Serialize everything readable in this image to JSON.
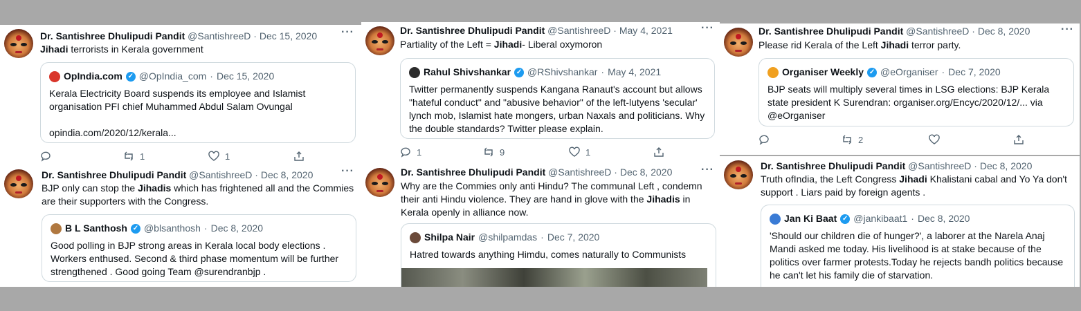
{
  "tweets": [
    {
      "name": "Dr. Santishree Dhulipudi Pandit",
      "handle": "@SantishreeD",
      "date": "Dec 15, 2020",
      "text_bold": "Jihadi",
      "text_after": " terrorists in Kerala government",
      "quote": {
        "name": "OpIndia.com",
        "handle": "@OpIndia_com",
        "date": "Dec 15, 2020",
        "text": "Kerala Electricity Board suspends its employee and Islamist organisation PFI chief Muhammed Abdul Salam Ovungal",
        "link": "opindia.com/2020/12/kerala..."
      },
      "actions": {
        "reply": "",
        "retweet": "1",
        "like": "1"
      }
    },
    {
      "name": "Dr. Santishree Dhulipudi Pandit",
      "handle": "@SantishreeD",
      "date": "May 4, 2021",
      "text_before": "Partiality of the Left = ",
      "text_bold": "Jihadi",
      "text_after": "- Liberal oxymoron",
      "quote": {
        "name": "Rahul Shivshankar",
        "handle": "@RShivshankar",
        "date": "May 4, 2021",
        "text": "Twitter permanently suspends Kangana Ranaut's account but allows \"hateful conduct\" and \"abusive behavior\" of the left-lutyens 'secular' lynch mob, Islamist hate mongers, urban Naxals and politicians. Why the double standards? Twitter please explain."
      },
      "actions": {
        "reply": "1",
        "retweet": "9",
        "like": "1"
      }
    },
    {
      "name": "Dr. Santishree Dhulipudi Pandit",
      "handle": "@SantishreeD",
      "date": "Dec 8, 2020",
      "text_before": "Please rid Kerala of the Left ",
      "text_bold": "Jihadi",
      "text_after": " terror party.",
      "quote": {
        "name": "Organiser Weekly",
        "handle": "@eOrganiser",
        "date": "Dec 7, 2020",
        "text": "BJP seats will multiply several times in LSG elections: BJP Kerala state president K Surendran: organiser.org/Encyc/2020/12/... via @eOrganiser"
      },
      "actions": {
        "reply": "",
        "retweet": "2",
        "like": ""
      }
    },
    {
      "name": "Dr. Santishree Dhulipudi Pandit",
      "handle": "@SantishreeD",
      "date": "Dec 8, 2020",
      "text_before": "BJP only can stop the ",
      "text_bold": "Jihadis",
      "text_after": " which has frightened all and the Commies are their supporters with the Congress.",
      "quote": {
        "name": "B L Santhosh",
        "handle": "@blsanthosh",
        "date": "Dec 8, 2020",
        "text": "Good polling in BJP strong areas in Kerala local body elections . Workers enthused. Second & third phase momentum will be further strengthened . Good going Team @surendranbjp . #KeralaVotesForBJP"
      }
    },
    {
      "name": "Dr. Santishree Dhulipudi Pandit",
      "handle": "@SantishreeD",
      "date": "Dec 8, 2020",
      "text_before": "Why are the Commies only anti Hindu? The communal Left , condemn their anti Hindu violence. They are hand in glove with the ",
      "text_bold": "Jihadis",
      "text_after": " in Kerala openly in alliance now.",
      "quote": {
        "name": "Shilpa Nair",
        "handle": "@shilpamdas",
        "date": "Dec 7, 2020",
        "text": "Hatred towards anything Himdu, comes naturally to Communists"
      }
    },
    {
      "name": "Dr. Santishree Dhulipudi Pandit",
      "handle": "@SantishreeD",
      "date": "Dec 8, 2020",
      "text_before": "Truth ofIndia, the Left Congress ",
      "text_bold": "Jihadi",
      "text_after": " Khalistani cabal and Yo Ya don't support . Liars paid by foreign agents .",
      "quote": {
        "name": "Jan Ki Baat",
        "handle": "@jankibaat1",
        "date": "Dec 8, 2020",
        "text": "'Should our children die of hunger?', a laborer at the Narela Anaj Mandi asked me today. His livelihood is at stake because of the politics over farmer protests.Today he rejects bandh politics because he can't let his family die of starvation."
      }
    }
  ],
  "separator": "·",
  "more_icon": "···",
  "colors": {
    "accent": "#1d9bf0",
    "muted": "#536471",
    "border": "#cfd9de",
    "background": "#a8a8a8"
  }
}
